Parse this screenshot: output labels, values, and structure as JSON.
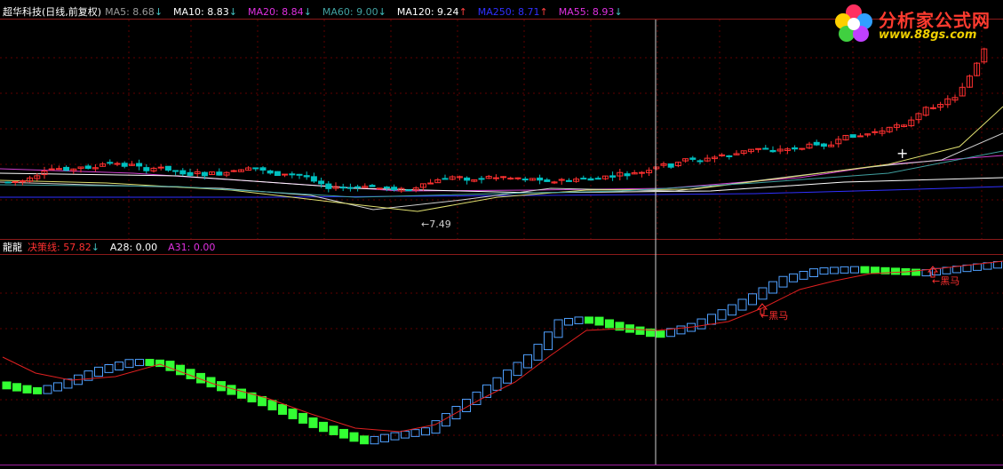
{
  "main_legend": {
    "title": "超华科技(日线,前复权)",
    "items": [
      {
        "label": "MA5: 8.68",
        "arrow": "↓",
        "color": "#9a9a9a",
        "arrow_color": "#40c0c0"
      },
      {
        "label": "MA10: 8.83",
        "arrow": "↓",
        "color": "#ffffff",
        "arrow_color": "#40c0c0"
      },
      {
        "label": "MA20: 8.84",
        "arrow": "↓",
        "color": "#e030e0",
        "arrow_color": "#40c0c0"
      },
      {
        "label": "MA60: 9.00",
        "arrow": "↓",
        "color": "#40a0a0",
        "arrow_color": "#40c0c0"
      },
      {
        "label": "MA120: 9.24",
        "arrow": "↑",
        "color": "#ffffff",
        "arrow_color": "#ff4040"
      },
      {
        "label": "MA250: 8.71",
        "arrow": "↑",
        "color": "#3030ff",
        "arrow_color": "#ff4040"
      },
      {
        "label": "MA55: 8.93",
        "arrow": "↓",
        "color": "#e030e0",
        "arrow_color": "#40c0c0"
      }
    ]
  },
  "low_annotation": "←7.49",
  "cursor_glyph": "+",
  "indicator_legend": {
    "name": "龍龍",
    "items": [
      {
        "label": "决策线: 57.82",
        "arrow": "↓",
        "color": "#ff3030",
        "arrow_color": "#40c0c0"
      },
      {
        "label": "A28: 0.00",
        "arrow": "",
        "color": "#ffffff",
        "arrow_color": "#ffffff"
      },
      {
        "label": "A31: 0.00",
        "arrow": "",
        "color": "#e030e0",
        "arrow_color": "#e030e0"
      }
    ]
  },
  "signals": [
    {
      "label": "←黑马"
    },
    {
      "label": "←黑马"
    }
  ],
  "logo": {
    "title": "分析家公式网",
    "url": "www.88gs.com"
  },
  "colors": {
    "up_candle": "#ff3030",
    "down_candle": "#00c0c0",
    "up_block": "#4fa0ff",
    "down_block": "#33ff33",
    "decision_line": "#e02020",
    "frame": "#8b1a1a"
  }
}
